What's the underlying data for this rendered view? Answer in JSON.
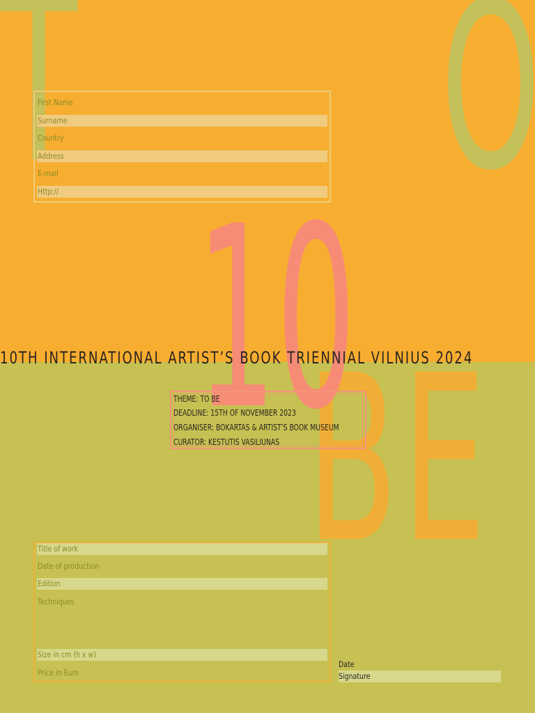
{
  "poster": {
    "big_letters": {
      "t": "T",
      "o": "O",
      "ten": "10",
      "be": "BE"
    },
    "headline": "10TH INTERNATIONAL ARTIST’S BOOK TRIENNIAL VILNIUS 2024",
    "colors": {
      "top_background": "#f7ae30",
      "bottom_background": "#c6c152",
      "ten_color": "#f88a78",
      "text_dark": "#2a2420",
      "field_label": "#8c8a26"
    }
  },
  "artist_form": {
    "fields": [
      {
        "label": "First Name",
        "value": ""
      },
      {
        "label": "Surname",
        "value": ""
      },
      {
        "label": "Country",
        "value": ""
      },
      {
        "label": "Address",
        "value": ""
      },
      {
        "label": "E-mail",
        "value": ""
      },
      {
        "label": "Http://",
        "value": ""
      }
    ]
  },
  "info": {
    "theme": "THEME: TO BE",
    "deadline": "DEADLINE: 15TH OF NOVEMBER 2023",
    "organiser": "ORGANISER: BOKARTAS & ARTIST’S BOOK MUSEUM",
    "curator": "CURATOR: KESTUTIS VASILIUNAS"
  },
  "work_form": {
    "fields": [
      {
        "label": "Title of work",
        "value": ""
      },
      {
        "label": "Date of production",
        "value": ""
      },
      {
        "label": "Edition",
        "value": ""
      },
      {
        "label": "Techniques",
        "value": ""
      },
      {
        "label": "Size in cm (h x w)",
        "value": ""
      },
      {
        "label": "Price in Euro",
        "value": ""
      }
    ]
  },
  "signoff": {
    "date_label": "Date",
    "signature_label": "Signature"
  }
}
